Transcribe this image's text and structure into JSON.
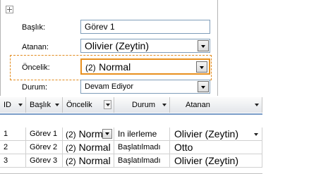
{
  "form": {
    "title_field": {
      "label": "Başlık:",
      "value": "Görev 1"
    },
    "assignee_field": {
      "label": "Atanan:",
      "value": "Olivier (Zeytin)"
    },
    "priority_field": {
      "label": "Öncelik:",
      "value_prefix": "(2)",
      "value": "Normal"
    },
    "status_field": {
      "label": "Durum:",
      "value": "Devam Ediyor"
    }
  },
  "table": {
    "columns": [
      "ID",
      "Başlık",
      "Öncelik",
      "Durum",
      "Atanan"
    ],
    "rows": [
      {
        "id": "1",
        "title": "Görev 1",
        "priority_prefix": "(2)",
        "priority": "Normal",
        "status": "In ilerleme",
        "assignee": "Olivier (Zeytin)"
      },
      {
        "id": "2",
        "title": "Görev 2",
        "priority_prefix": "(2)",
        "priority": "Normal",
        "status": "Başlatılmadı",
        "assignee": "Otto"
      },
      {
        "id": "3",
        "title": "Görev 3",
        "priority_prefix": "(2)",
        "priority": "Normal",
        "status": "Başlatılmadı",
        "assignee": "Olivier (Zeytin)"
      }
    ]
  }
}
